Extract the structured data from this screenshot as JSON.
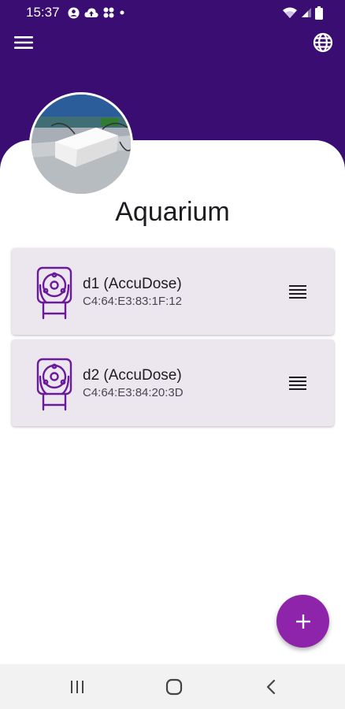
{
  "status_bar": {
    "time": "15:37",
    "notification_icons": [
      "account-circle-icon",
      "cloud-upload-icon",
      "apps-grid-icon",
      "dot-icon"
    ],
    "system_icons": [
      "wifi-icon",
      "cellular-signal-icon",
      "battery-icon"
    ]
  },
  "app_bar": {
    "menu_icon": "hamburger-menu-icon",
    "language_icon": "globe-icon"
  },
  "header": {
    "title": "Aquarium"
  },
  "devices": [
    {
      "name": "d1 (AccuDose)",
      "mac": "C4:64:E3:83:1F:12",
      "icon": "peristaltic-pump-icon"
    },
    {
      "name": "d2 (AccuDose)",
      "mac": "C4:64:E3:84:20:3D",
      "icon": "peristaltic-pump-icon"
    }
  ],
  "fab": {
    "icon": "plus-icon"
  },
  "nav_bar": {
    "icons": [
      "recents-icon",
      "home-icon",
      "back-icon"
    ]
  },
  "colors": {
    "header_bg": "#3a0d73",
    "card_bg": "#ece6ef",
    "pump_icon": "#6a1b9a",
    "fab_bg": "#8e24aa",
    "nav_bg": "#f2f2f2"
  }
}
